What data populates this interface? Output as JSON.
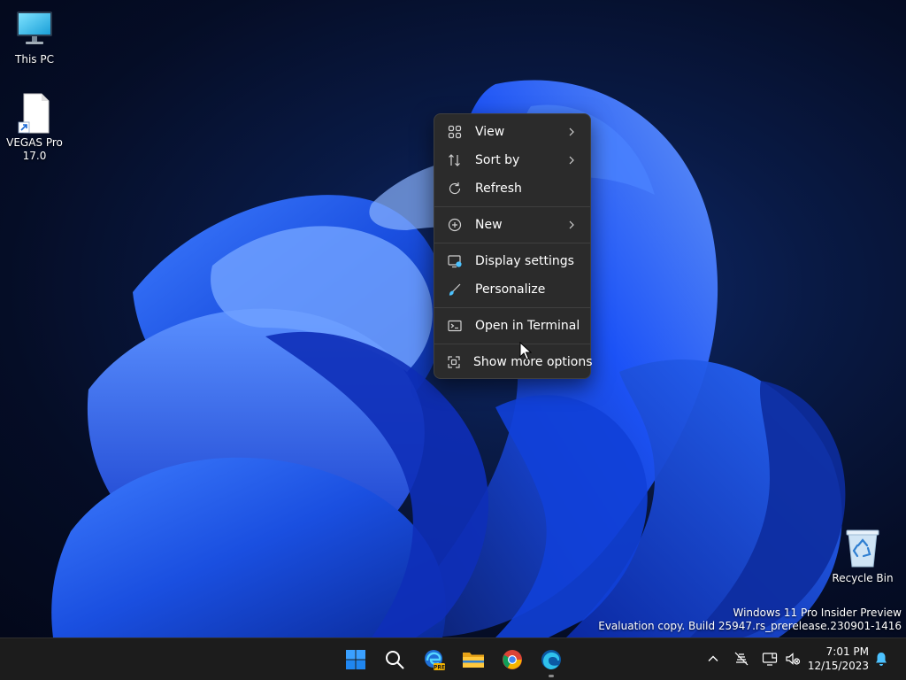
{
  "desktop": {
    "icons": [
      {
        "label": "This PC",
        "icon": "monitor-icon"
      },
      {
        "label": "VEGAS Pro 17.0",
        "icon": "shortcut-file-icon"
      },
      {
        "label": "Recycle Bin",
        "icon": "recycle-bin-icon"
      }
    ]
  },
  "context_menu": {
    "items": [
      {
        "label": "View",
        "icon": "grid-icon",
        "submenu": true
      },
      {
        "label": "Sort by",
        "icon": "sort-icon",
        "submenu": true
      },
      {
        "label": "Refresh",
        "icon": "refresh-icon",
        "submenu": false
      },
      {
        "label": "New",
        "icon": "plus-circle-icon",
        "submenu": true
      },
      {
        "label": "Display settings",
        "icon": "display-icon",
        "submenu": false
      },
      {
        "label": "Personalize",
        "icon": "brush-icon",
        "submenu": false
      },
      {
        "label": "Open in Terminal",
        "icon": "terminal-icon",
        "submenu": false
      },
      {
        "label": "Show more options",
        "icon": "expand-icon",
        "submenu": false
      }
    ]
  },
  "watermark": {
    "line1": "Windows 11 Pro Insider Preview",
    "line2": "Evaluation copy. Build 25947.rs_prerelease.230901-1416"
  },
  "taskbar": {
    "apps": [
      {
        "name": "start",
        "icon": "windows-logo-icon"
      },
      {
        "name": "search",
        "icon": "search-icon"
      },
      {
        "name": "edge-preview",
        "icon": "edge-preview-icon",
        "badge": "PRE"
      },
      {
        "name": "file-explorer",
        "icon": "folder-icon"
      },
      {
        "name": "chrome",
        "icon": "chrome-icon"
      },
      {
        "name": "edge",
        "icon": "edge-icon",
        "running": true
      }
    ],
    "tray": {
      "icons": [
        "chevron-up-icon",
        "network-off-icon",
        "display-project-icon",
        "volume-muted-icon",
        "notification-bell-icon"
      ]
    },
    "clock": {
      "time": "7:01 PM",
      "date": "12/15/2023"
    }
  },
  "colors": {
    "menu_bg": "#2b2b2b",
    "menu_border": "#3f3f3f",
    "taskbar_bg": "#1c1c1c",
    "accent_blue": "#1a5cff",
    "wallpaper_dark": "#050d26"
  }
}
